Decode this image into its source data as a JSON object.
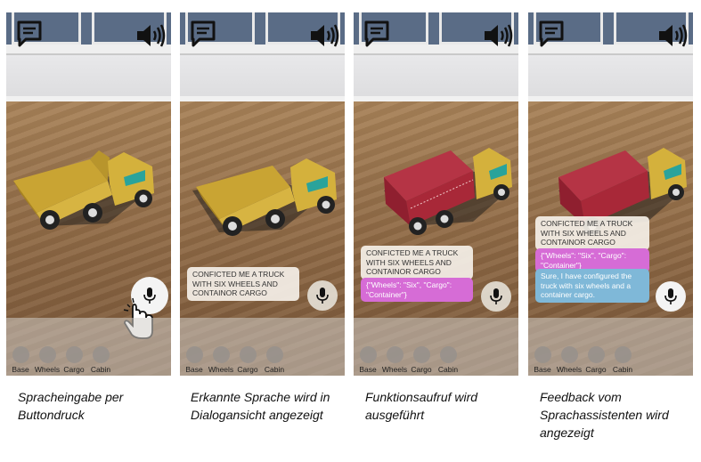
{
  "panels": [
    {
      "dialog": [],
      "menu": [
        "Base",
        "Wheels",
        "Cargo",
        "Cabin"
      ],
      "caption": "Spracheingabe per Buttondruck"
    },
    {
      "dialog": [
        {
          "type": "user",
          "text": "CONFICTED ME A TRUCK WITH SIX WHEELS AND CONTAINOR CARGO"
        }
      ],
      "menu": [
        "Base",
        "Wheels",
        "Cargo",
        "Cabin"
      ],
      "caption": "Erkannte Sprache wird in Dialogansicht angezeigt"
    },
    {
      "dialog": [
        {
          "type": "user",
          "text": "CONFICTED ME A TRUCK WITH SIX WHEELS AND CONTAINOR CARGO"
        },
        {
          "type": "function",
          "text": "{\"Wheels\": \"Six\", \"Cargo\": \"Container\"}"
        }
      ],
      "menu": [
        "Base",
        "Wheels",
        "Cargo",
        "Cabin"
      ],
      "caption": "Funktionsaufruf wird ausgeführt"
    },
    {
      "dialog": [
        {
          "type": "user",
          "text": "CONFICTED ME A TRUCK WITH SIX WHEELS AND CONTAINOR CARGO"
        },
        {
          "type": "function",
          "text": "{\"Wheels\": \"Six\", \"Cargo\": \"Container\"}"
        },
        {
          "type": "assistant",
          "text": "Sure, I have configured the truck with six wheels and a container cargo."
        }
      ],
      "menu": [
        "Base",
        "Wheels",
        "Cargo",
        "Cabin"
      ],
      "caption": "Feedback vom Sprachassistenten wird angezeigt"
    }
  ],
  "icons": {
    "chat": "chat-bubble-icon",
    "speaker": "speaker-icon",
    "mic": "microphone-icon",
    "hand": "tap-hand-icon"
  },
  "colors": {
    "truck_body": "#d4b13c",
    "cargo_container": "#a82838",
    "function_bubble": "#d66cd6",
    "assistant_bubble": "#7fb8d8"
  }
}
